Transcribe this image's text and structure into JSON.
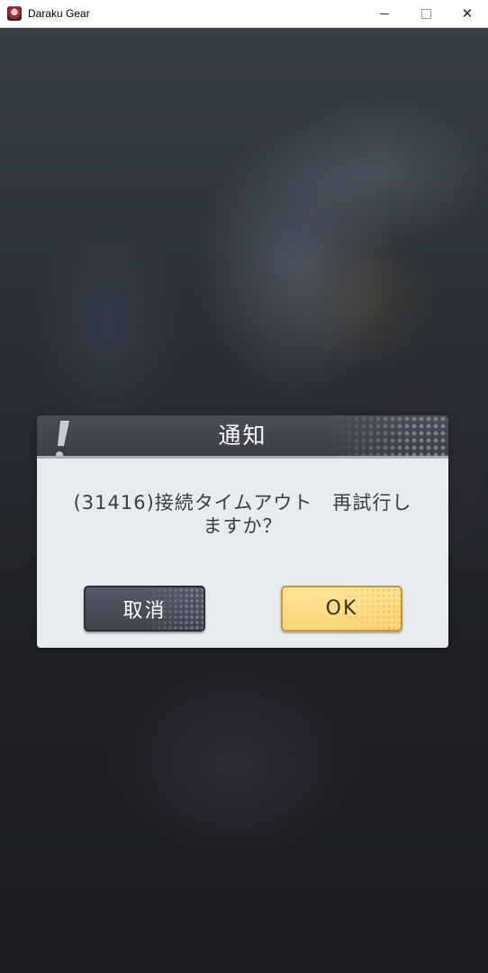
{
  "window": {
    "title": "Daraku Gear",
    "minimize_label": "—",
    "maximize_label": "☐",
    "close_label": "✕"
  },
  "dialog": {
    "title": "通知",
    "message": "(31416)接続タイムアウト　再試行しますか？",
    "cancel_label": "取消",
    "ok_label": "OK"
  },
  "colors": {
    "header": "#3c3f48",
    "body": "#e8ebf0",
    "cancel_button": "#4a4e58",
    "ok_button": "#fcd777"
  },
  "icons": {
    "app": "app-icon",
    "alert": "exclamation-icon"
  }
}
